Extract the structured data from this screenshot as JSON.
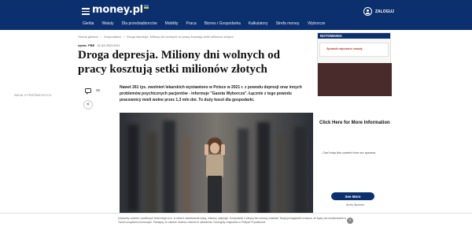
{
  "brand": {
    "name": "money.pl",
    "flag_colors": [
      "#3b6fd8",
      "#f5d400"
    ]
  },
  "header": {
    "login_label": "ZALOGUJ"
  },
  "nav": [
    {
      "label": "Gielda"
    },
    {
      "label": "Waluty"
    },
    {
      "label": "Dla przedsiębiorców"
    },
    {
      "label": "Mobility"
    },
    {
      "label": "Praca"
    },
    {
      "label": "Biznes i Gospodarka"
    },
    {
      "label": "Kalkulatory"
    },
    {
      "label": "Strefa money."
    },
    {
      "label": "Wyborcze"
    }
  ],
  "breadcrumb": [
    "Strona główna",
    "›",
    "Gospodarka",
    "›",
    "Droga depresja. Miliony dni wolnych od pracy kosztują setki milionów złotych"
  ],
  "meta": {
    "author": "oprac. PBE",
    "date": "31.03.2023 8:01"
  },
  "article": {
    "title": "Droga depresja. Miliony dni wolnych od pracy kosztują setki milionów złotych",
    "lead": "Nawet 261 tys. zwolnień lekarskich wystawiono w Polsce w 2021 r. z powodu depresji oraz innych problemów psychicznych pacjentów - informuje \"Gazeta Wyborcza\". Łącznie z tego powodu pracownicy mieli wolne przez 1,3 mln dni. To duży koszt dla gospodarki.",
    "comment_count": "25"
  },
  "right_column": {
    "notowania_label": "NOTOWANIA",
    "ad_label": "Sprawdź najnowsze zasady",
    "caption": "WAKAL S PRZEŚNIEJSZYCH",
    "promo_title": "Click Here for More Information",
    "promo_text": "Can't stop this content from our sponsor.",
    "see_more_label": "See More",
    "ad_by": "Ad by Sponsor"
  },
  "cookie": {
    "text": "Używamy cookies i podobnych technologii m.in. w celach: świadczenia usług, reklamy, statystyk. Korzystanie z witryny bez zmiany ustawień Twojej przeglądarki oznacza, że będą one umieszczane w Twoim urządzeniu końcowym. Pamiętaj, że zawsze możesz zmienić te ustawienia. Szczegóły znajdziesz w Polityce Prywatności.",
    "close_label": "×"
  },
  "colors": {
    "nav_bg": "#0c2f6e",
    "accent": "#0c2f6e"
  },
  "icons": [
    "hamburger-icon",
    "user-icon",
    "comment-icon",
    "share-icon"
  ]
}
